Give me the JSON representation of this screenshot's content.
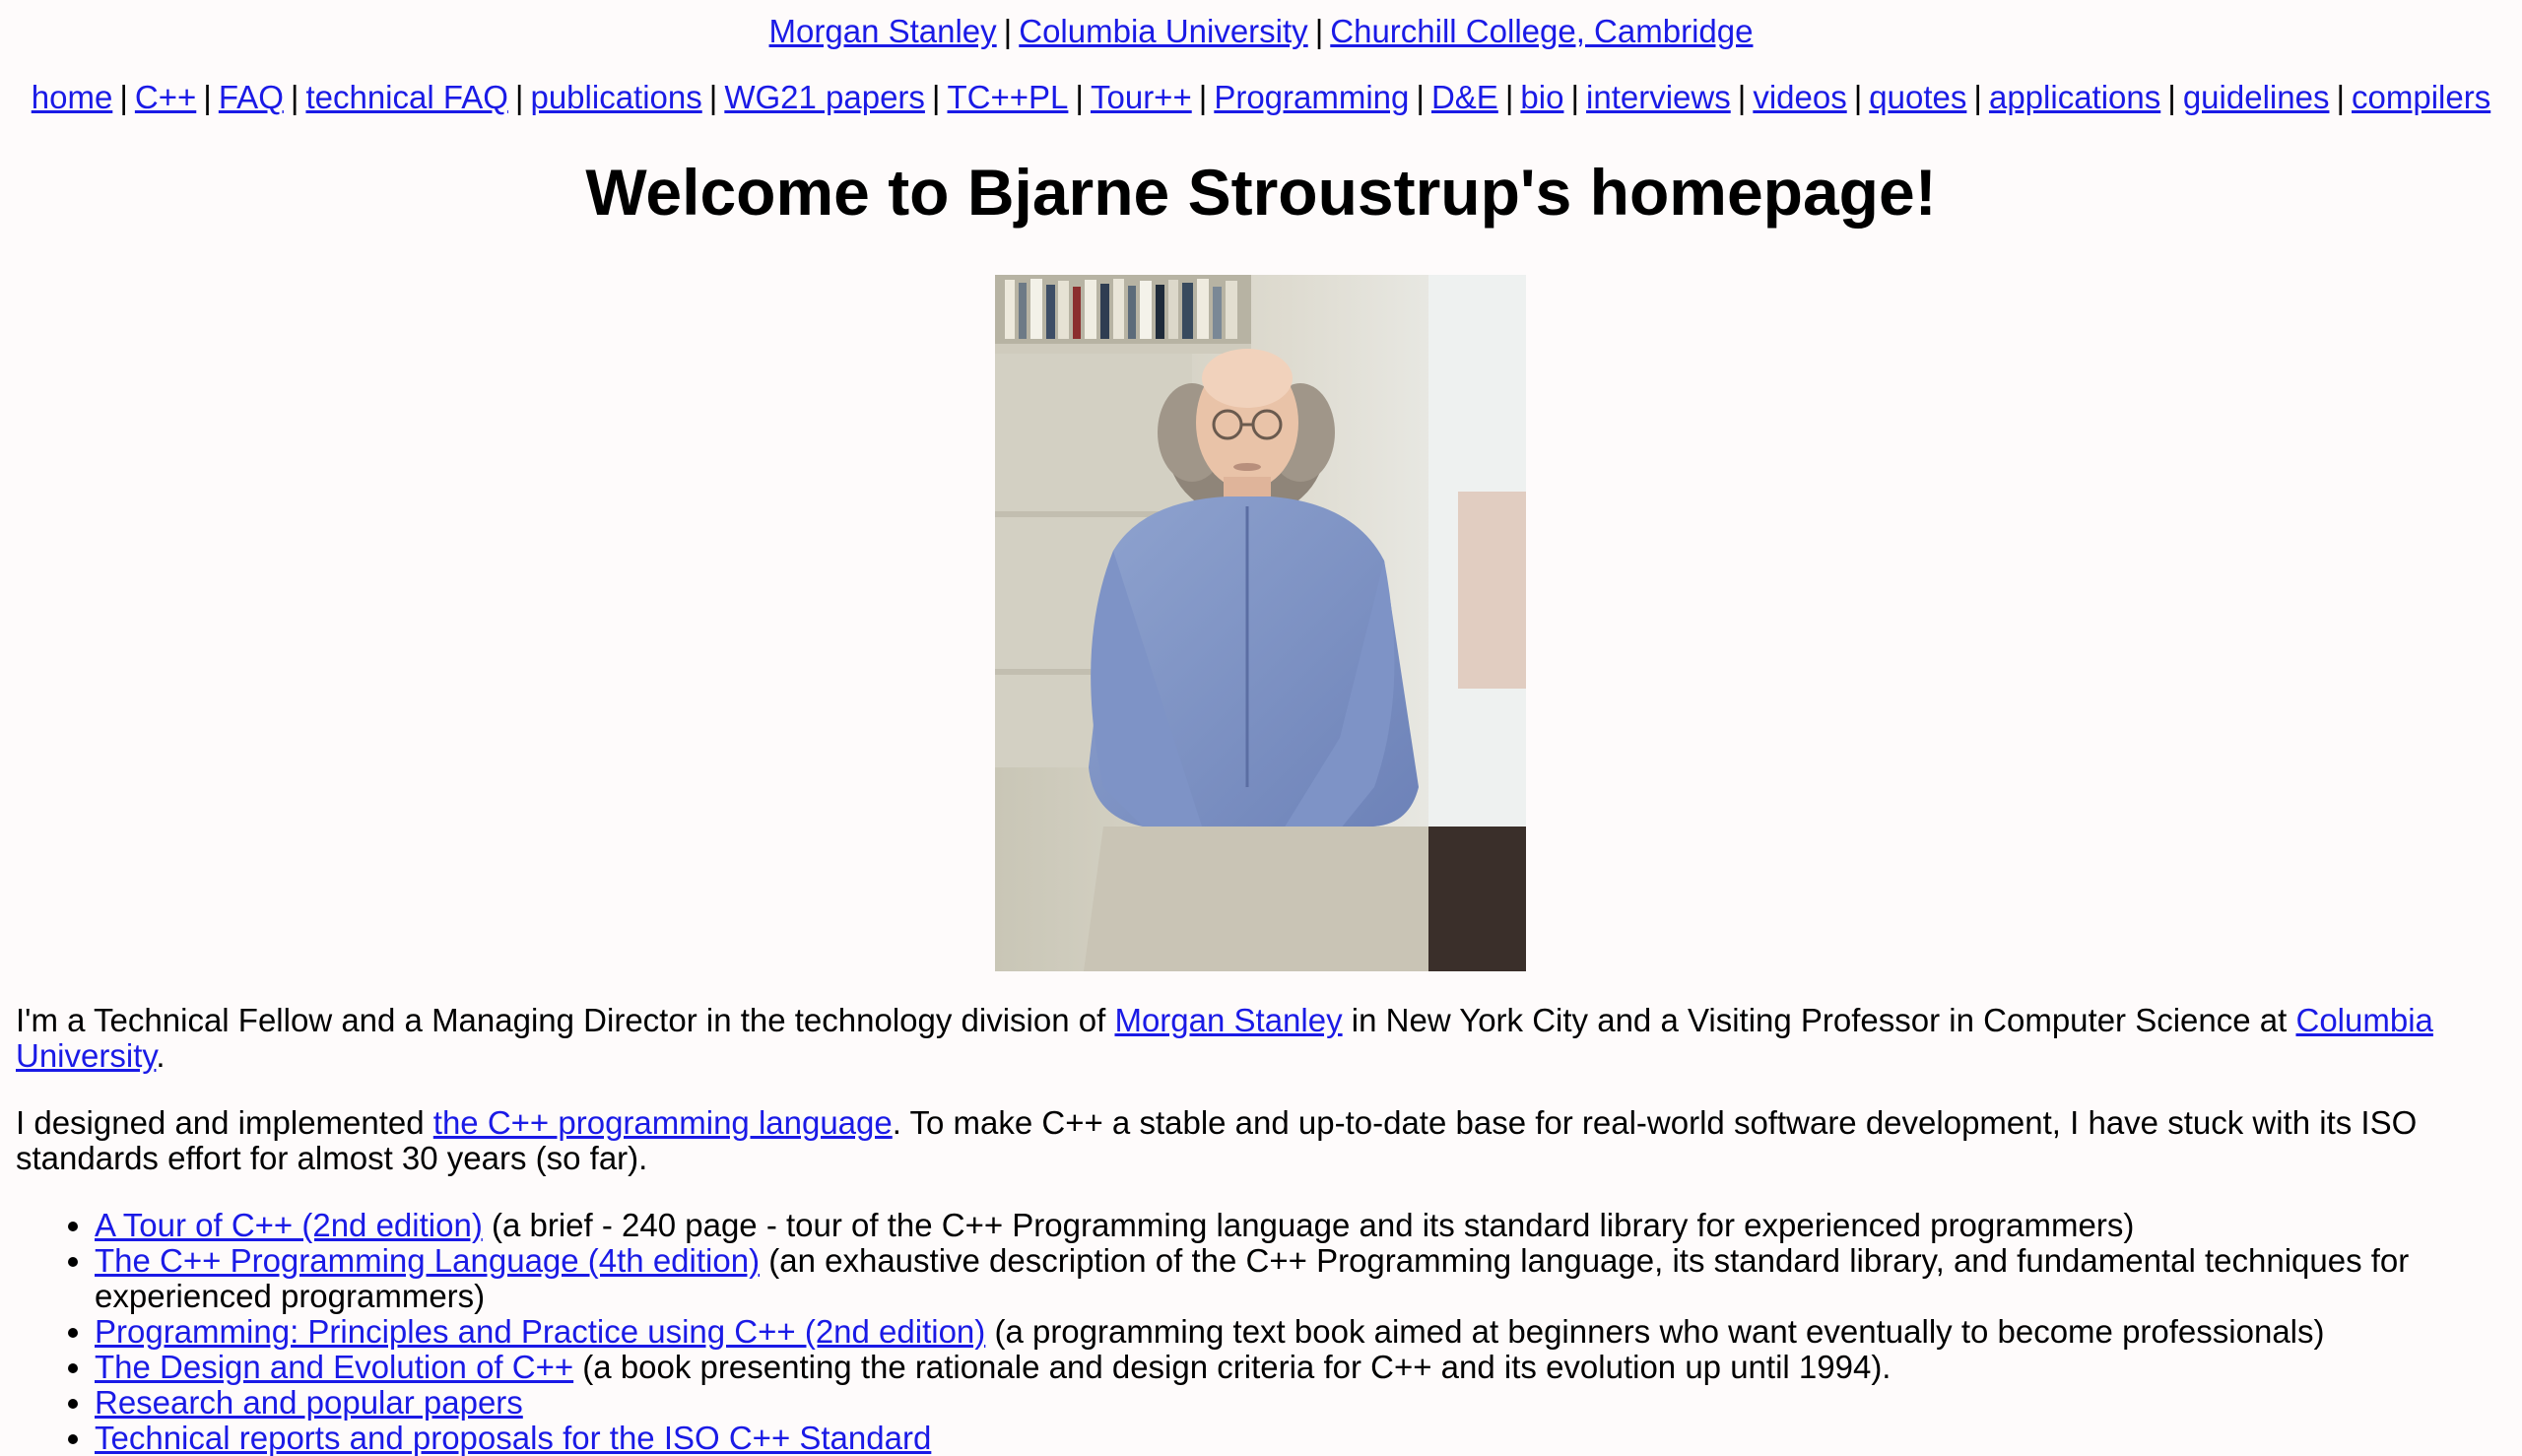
{
  "affiliations": [
    {
      "label": "Morgan Stanley"
    },
    {
      "label": "Columbia University"
    },
    {
      "label": "Churchill College, Cambridge"
    }
  ],
  "separator": "|",
  "nav": [
    {
      "label": "home"
    },
    {
      "label": "C++"
    },
    {
      "label": "FAQ"
    },
    {
      "label": "technical FAQ"
    },
    {
      "label": "publications"
    },
    {
      "label": "WG21 papers"
    },
    {
      "label": "TC++PL"
    },
    {
      "label": "Tour++"
    },
    {
      "label": "Programming"
    },
    {
      "label": "D&E"
    },
    {
      "label": "bio"
    },
    {
      "label": "interviews"
    },
    {
      "label": "videos"
    },
    {
      "label": "quotes"
    },
    {
      "label": "applications"
    },
    {
      "label": "guidelines"
    },
    {
      "label": "compilers"
    }
  ],
  "title": "Welcome to Bjarne Stroustrup's homepage!",
  "intro1": {
    "t1": "I'm a Technical Fellow and a Managing Director in the technology division of ",
    "link1": "Morgan Stanley",
    "t2": " in New York City and a Visiting Professor in Computer Science at ",
    "link2": "Columbia University",
    "t3": "."
  },
  "intro2": {
    "t1": "I designed and implemented ",
    "link": "the C++ programming language",
    "t2": ". To make C++ a stable and up-to-date base for real-world software development, I have stuck with its ISO standards effort for almost 30 years (so far)."
  },
  "books": [
    {
      "link": "A Tour of C++ (2nd edition)",
      "desc": " (a brief - 240 page - tour of the C++ Programming language and its standard library for experienced programmers)"
    },
    {
      "link": "The C++ Programming Language (4th edition)",
      "desc": " (an exhaustive description of the C++ Programming language, its standard library, and fundamental techniques for experienced programmers)"
    },
    {
      "link": "Programming: Principles and Practice using C++ (2nd edition)",
      "desc": " (a programming text book aimed at beginners who want eventually to become professionals)"
    },
    {
      "link": "The Design and Evolution of C++",
      "desc": " (a book presenting the rationale and design criteria for C++ and its evolution up until 1994)."
    },
    {
      "link": "Research and popular papers",
      "desc": ""
    },
    {
      "link": "Technical reports and proposals for the ISO C++ Standard",
      "desc": ""
    }
  ]
}
